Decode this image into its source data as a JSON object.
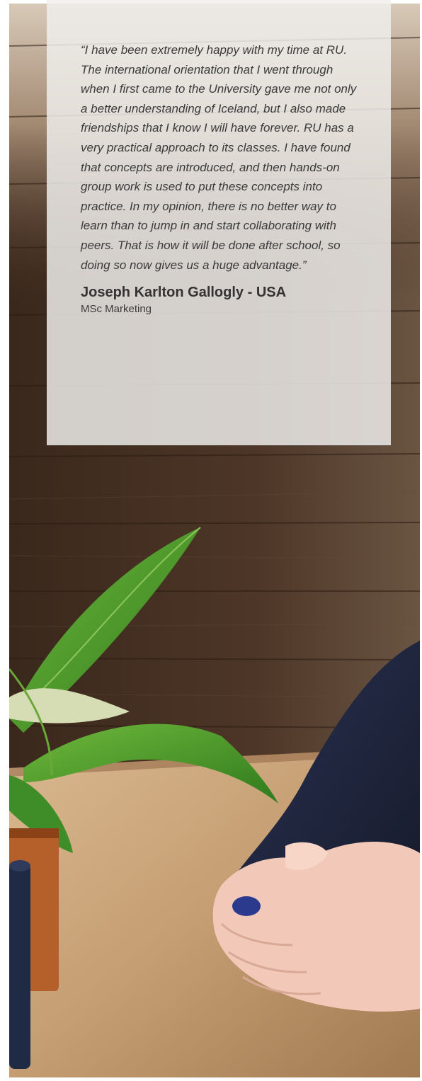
{
  "testimonial": {
    "quote": "“I have been extremely happy with my time at RU. The international orientation that I went through when I first came to the University gave me not only a better understanding of Iceland, but I also made friendships that I know I will have forever. RU has a very practical approach to its classes. I have found that concepts are introduced, and then hands-on group work is used to put these concepts into practice. In my opinion, there is no better way to learn than to jump in and start collaborating with peers. That is how it will be done after school, so doing so now gives us a huge advantage.”",
    "author": "Joseph Karlton Gallogly - USA",
    "program": "MSc Marketing"
  },
  "colors": {
    "card_background": "#f0eeec",
    "text": "#3a3a3a",
    "wood_wall": "#4a3325",
    "table": "#c9a47c",
    "sweater": "#1e2438",
    "leaf": "#4f9a2e"
  },
  "icons": {
    "background": "photo-plant-table-hands"
  }
}
